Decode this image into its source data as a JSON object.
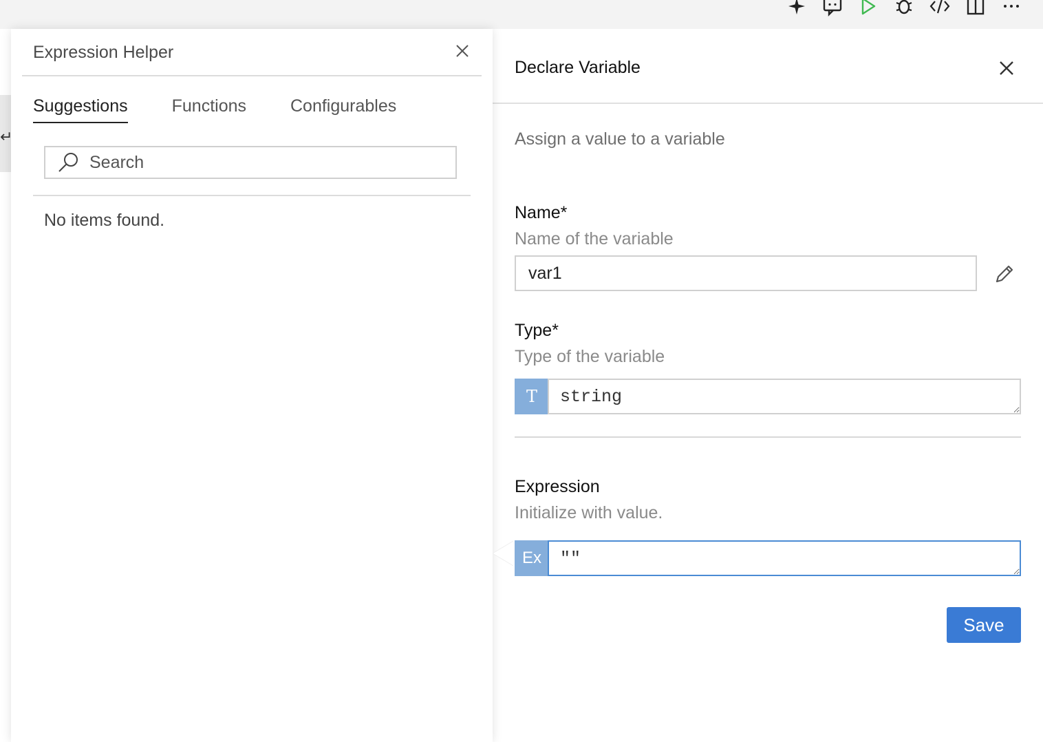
{
  "toolbar": {
    "icons": [
      "sparkle-icon",
      "chat-icon",
      "run-icon",
      "debug-icon",
      "code-icon",
      "split-view-icon",
      "more-icon"
    ],
    "run_color": "#3fb950"
  },
  "expression_helper": {
    "title": "Expression Helper",
    "tabs": [
      {
        "label": "Suggestions",
        "active": true
      },
      {
        "label": "Functions",
        "active": false
      },
      {
        "label": "Configurables",
        "active": false
      }
    ],
    "search": {
      "placeholder": "Search",
      "value": ""
    },
    "empty_message": "No items found."
  },
  "declare_variable": {
    "title": "Declare Variable",
    "description": "Assign a value to a variable",
    "name_field": {
      "label": "Name*",
      "hint": "Name of the variable",
      "value": "var1"
    },
    "type_field": {
      "label": "Type*",
      "hint": "Type of the variable",
      "prefix": "T",
      "value": "string"
    },
    "expression_field": {
      "label": "Expression",
      "hint": "Initialize with value.",
      "prefix": "Ex",
      "value": "\"\""
    },
    "save_label": "Save"
  },
  "colors": {
    "accent": "#3a7bd5",
    "prefix_bg": "#85aedb",
    "focus_border": "#4a8bd4"
  }
}
